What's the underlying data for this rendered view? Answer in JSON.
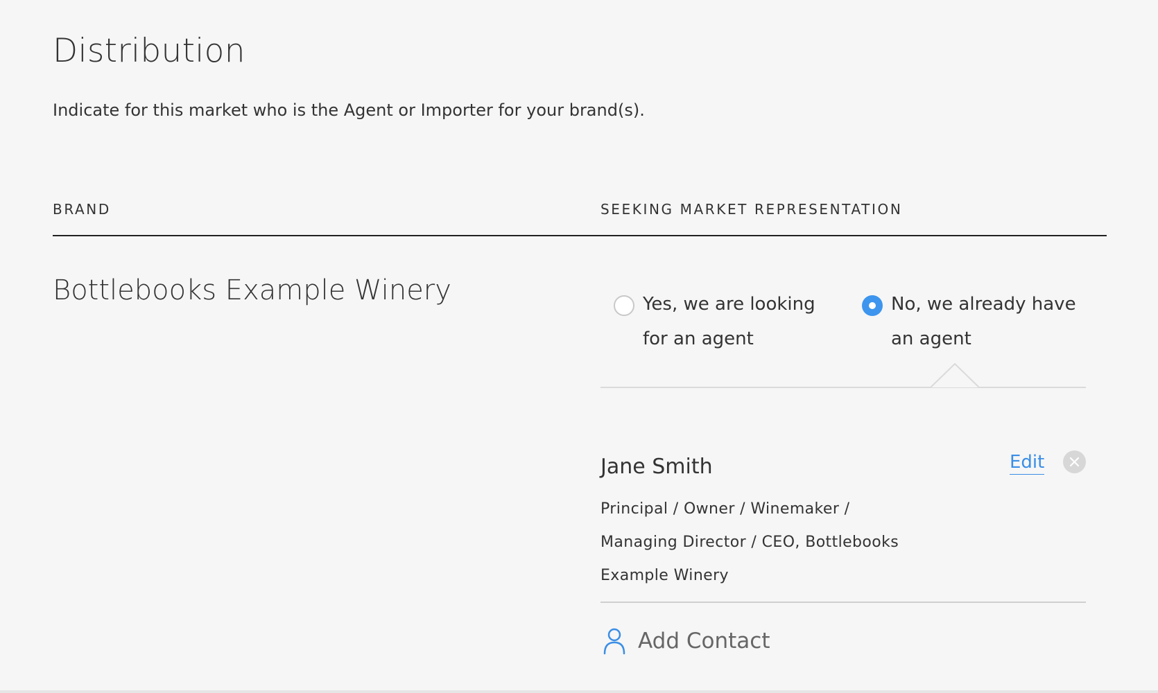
{
  "header": {
    "title": "Distribution",
    "subtitle": "Indicate for this market who is the Agent or Importer for your brand(s)."
  },
  "table": {
    "columns": {
      "brand": "BRAND",
      "seeking": "SEEKING MARKET REPRESENTATION"
    },
    "rows": [
      {
        "brand": "Bottlebooks Example Winery",
        "options": [
          {
            "label": "Yes, we are looking for an agent",
            "selected": false
          },
          {
            "label": "No, we already have an agent",
            "selected": true
          }
        ],
        "contact": {
          "name": "Jane Smith",
          "role": "Principal / Owner / Winemaker / Managing Director / CEO, Bottlebooks Example Winery",
          "edit_label": "Edit"
        },
        "add_contact_label": "Add Contact"
      }
    ]
  },
  "colors": {
    "accent": "#3d95ee",
    "link": "#3a8ee6",
    "background": "#f6f6f6"
  },
  "icons": {
    "remove": "close-circle-icon",
    "add_contact": "person-icon"
  }
}
